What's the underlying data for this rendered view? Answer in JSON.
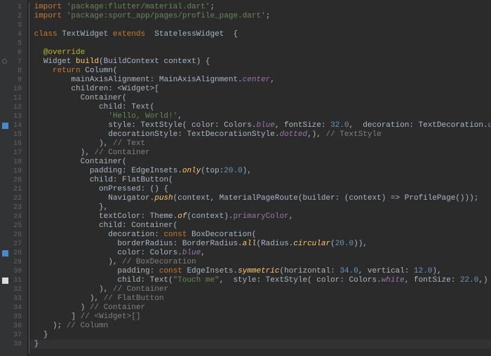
{
  "gutter": {
    "lines": [
      {
        "n": "1"
      },
      {
        "n": "2"
      },
      {
        "n": "3"
      },
      {
        "n": "4"
      },
      {
        "n": "5"
      },
      {
        "n": "6"
      },
      {
        "n": "7",
        "marker": "circle"
      },
      {
        "n": "8"
      },
      {
        "n": "9"
      },
      {
        "n": "10"
      },
      {
        "n": "11"
      },
      {
        "n": "12"
      },
      {
        "n": "13"
      },
      {
        "n": "14",
        "marker": "blue"
      },
      {
        "n": "15"
      },
      {
        "n": "16"
      },
      {
        "n": "17"
      },
      {
        "n": "18"
      },
      {
        "n": "19"
      },
      {
        "n": "20"
      },
      {
        "n": "21"
      },
      {
        "n": "22"
      },
      {
        "n": "23"
      },
      {
        "n": "24"
      },
      {
        "n": "25"
      },
      {
        "n": "26"
      },
      {
        "n": "27"
      },
      {
        "n": "28",
        "marker": "blue"
      },
      {
        "n": "29"
      },
      {
        "n": "30"
      },
      {
        "n": "31",
        "marker": "white"
      },
      {
        "n": "32"
      },
      {
        "n": "33"
      },
      {
        "n": "34"
      },
      {
        "n": "35"
      },
      {
        "n": "36"
      },
      {
        "n": "37"
      },
      {
        "n": "38"
      }
    ]
  },
  "code": {
    "l1_kw": "import ",
    "l1_str": "'package:flutter/material.dart'",
    "l1_p": ";",
    "l2_kw": "import ",
    "l2_str": "'package:sport_app/pages/profile_page.dart'",
    "l2_p": ";",
    "l4_kw1": "class ",
    "l4_cls": "TextWidget ",
    "l4_kw2": "extends  ",
    "l4_sup": "StatelessWidget  ",
    "l4_b": "{",
    "l6_anno": "@override",
    "l7_t": "Widget ",
    "l7_fn": "build",
    "l7_p1": "(BuildContext context) {",
    "l8_kw": "return ",
    "l8_c": "Column(",
    "l9_a": "mainAxisAlignment: MainAxisAlignment.",
    "l9_b": "center",
    "l9_c": ",",
    "l10_a": "children: <Widget>[",
    "l11_a": "Container(",
    "l12_a": "child: Text(",
    "l13_a": "'Hello, World!'",
    "l13_b": ",",
    "l14_a": "style: TextStyle( color: Colors.",
    "l14_b": "blue",
    "l14_c": ", fontSize: ",
    "l14_d": "32.0",
    "l14_e": ",  decoration: TextDecoration.",
    "l14_f": "underline",
    "l14_g": ",",
    "l15_a": "decorationStyle: TextDecorationStyle.",
    "l15_b": "dotted",
    "l15_c": ",), ",
    "l15_d": "// TextStyle",
    "l16_a": "), ",
    "l16_b": "// Text",
    "l17_a": "), ",
    "l17_b": "// Container",
    "l18_a": "Container(",
    "l19_a": "padding: EdgeInsets.",
    "l19_b": "only",
    "l19_c": "(top:",
    "l19_d": "20.0",
    "l19_e": "),",
    "l20_a": "child: FlatButton(",
    "l21_a": "onPressed: () {",
    "l22_a": "Navigator.",
    "l22_b": "push",
    "l22_c": "(context, MaterialPageRoute(builder: (context) => ProfilePage()));",
    "l23_a": "},",
    "l24_a": "textColor: Theme.",
    "l24_b": "of",
    "l24_c": "(context).",
    "l24_d": "primaryColor",
    "l24_e": ",",
    "l25_a": "child: Container(",
    "l26_a": "decoration: ",
    "l26_kw": "const ",
    "l26_b": "BoxDecoration(",
    "l27_a": "borderRadius: BorderRadius.",
    "l27_b": "all",
    "l27_c": "(Radius.",
    "l27_d": "circular",
    "l27_e": "(",
    "l27_f": "20.0",
    "l27_g": ")),",
    "l28_a": "color: Colors.",
    "l28_b": "blue",
    "l28_c": ",",
    "l29_a": "), ",
    "l29_b": "// BoxDecoration",
    "l30_a": "padding: ",
    "l30_kw": "const ",
    "l30_b": "EdgeInsets.",
    "l30_c": "symmetric",
    "l30_d": "(horizontal: ",
    "l30_e": "34.0",
    "l30_f": ", vertical: ",
    "l30_g": "12.0",
    "l30_h": "),",
    "l31_a": "child: Text(",
    "l31_b": "\"Touch me\"",
    "l31_c": ",  style: TextStyle( color: Colors.",
    "l31_d": "white",
    "l31_e": ", fontSize: ",
    "l31_f": "22.0",
    "l31_g": ",) ),",
    "l32_a": "), ",
    "l32_b": "// Container",
    "l33_a": "), ",
    "l33_b": "// FlatButton",
    "l34_a": ") ",
    "l34_b": "// Container",
    "l35_a": "] ",
    "l35_b": "// <Widget>[]",
    "l36_a": "); ",
    "l36_b": "// Column",
    "l37_a": "}",
    "l38_a": "}"
  }
}
